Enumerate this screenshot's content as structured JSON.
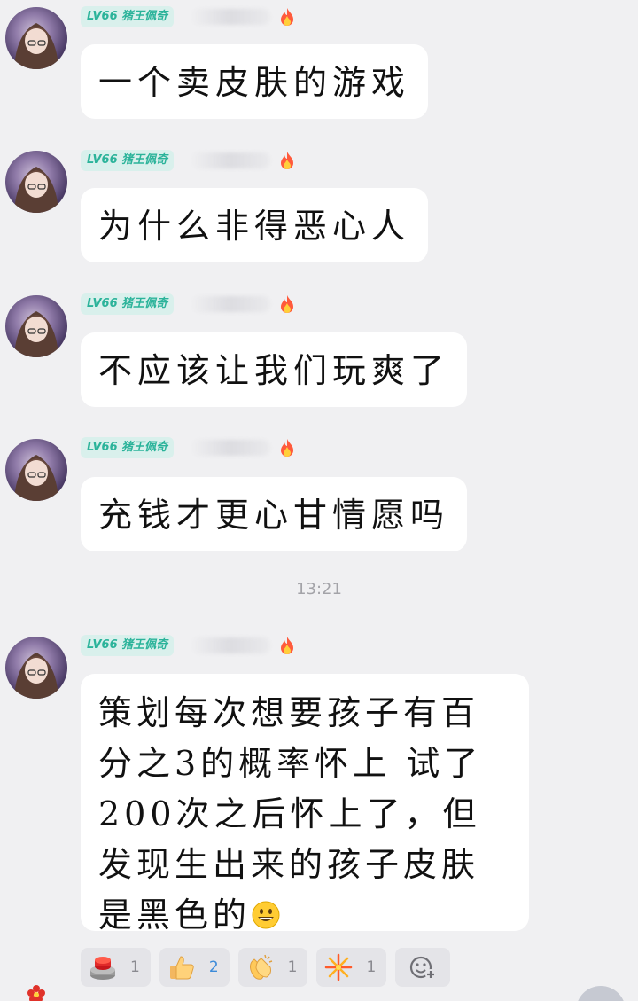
{
  "messages": [
    {
      "level_badge": "LV66 猪王佩奇",
      "text": "一个卖皮肤的游戏"
    },
    {
      "level_badge": "LV66 猪王佩奇",
      "text": "为什么非得恶心人"
    },
    {
      "level_badge": "LV66 猪王佩奇",
      "text": "不应该让我们玩爽了"
    },
    {
      "level_badge": "LV66 猪王佩奇",
      "text": "充钱才更心甘情愿吗"
    },
    {
      "level_badge": "LV66 猪王佩奇",
      "text": "策划每次想要孩子有百分之3的概率怀上 试了200次之后怀上了，但发现生出来的孩子皮肤是黑色的"
    }
  ],
  "timestamp": "13:21",
  "reactions": [
    {
      "icon": "red-button-icon",
      "count": "1"
    },
    {
      "icon": "thumbs-up-icon",
      "count": "2"
    },
    {
      "icon": "clapping-hands-icon",
      "count": "1"
    },
    {
      "icon": "fireworks-icon",
      "count": "1"
    }
  ],
  "colors": {
    "background": "#f0f0f2",
    "bubble": "#ffffff",
    "badge_bg": "#d9f0ec",
    "badge_text": "#2bb39a",
    "active_count": "#3d8bd9"
  }
}
